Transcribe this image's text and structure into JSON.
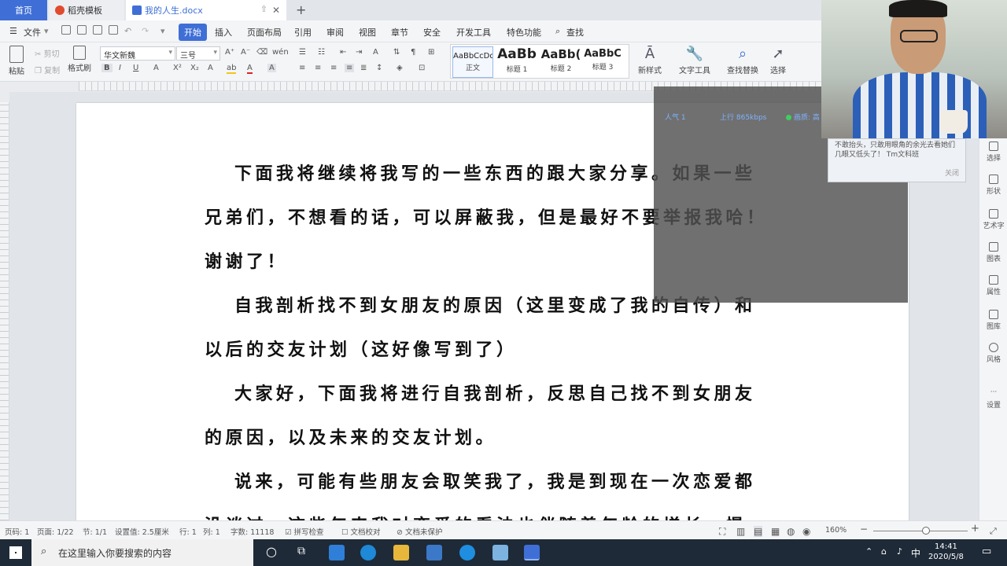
{
  "tabs": [
    {
      "label": "首页"
    },
    {
      "label": "稻壳模板"
    },
    {
      "label": "我的人生.docx"
    }
  ],
  "menu": {
    "file": "文件",
    "items": [
      "开始",
      "插入",
      "页面布局",
      "引用",
      "审阅",
      "视图",
      "章节",
      "安全",
      "开发工具",
      "特色功能"
    ],
    "search": "查找"
  },
  "ribbon": {
    "paste": "粘贴",
    "cut": "剪切",
    "copy": "复制",
    "format_painter": "格式刷",
    "font_name": "华文新魏",
    "font_size": "三号",
    "styles": [
      {
        "preview": "AaBbCcDd",
        "name": "正文"
      },
      {
        "preview": "AaBb",
        "name": "标题 1"
      },
      {
        "preview": "AaBb(",
        "name": "标题 2"
      },
      {
        "preview": "AaBbC",
        "name": "标题 3"
      }
    ],
    "new_style": "新样式",
    "text_tools": "文字工具",
    "find_replace": "查找替换",
    "select": "选择"
  },
  "document": {
    "paragraphs": [
      {
        "lines": [
          "下面我将继续将我写的一些东西的跟大家分享。如果一些",
          "兄弟们，不想看的话，可以屏蔽我，但是最好不要举报我哈！",
          "谢谢了！"
        ]
      },
      {
        "lines": [
          "自我剖析找不到女朋友的原因（这里变成了我的自传）和",
          "以后的交友计划（这好像写到了）"
        ]
      },
      {
        "lines": [
          "大家好，下面我将进行自我剖析，反思自己找不到女朋友",
          "的原因，以及未来的交友计划。"
        ]
      },
      {
        "lines": [
          "说来，可能有些朋友会取笑我了，我是到现在一次恋爱都",
          "没谈过，这些年来我对恋爱的看法也伴随着年龄的增长，慢"
        ]
      }
    ]
  },
  "overlay": {
    "popularity": "人气  1",
    "upload": "上行  865kbps",
    "quality": "画质: 高"
  },
  "chat": {
    "text": "不敢抬头，只敢用眼角的余光去看她们几眼又低头了！ Tm文科班",
    "close": "关闭"
  },
  "side_panel": [
    "选择",
    "形状",
    "艺术字",
    "图表",
    "属性",
    "图库",
    "风格",
    "设置"
  ],
  "status": {
    "page_code": "页码: 1",
    "page": "页面: 1/22",
    "section": "节: 1/1",
    "setting": "设置值: 2.5厘米",
    "row": "行: 1",
    "col": "列: 1",
    "words": "字数: 11118",
    "spell": "拼写检查",
    "proof": "文档校对",
    "protect": "文档未保护",
    "zoom": "160%"
  },
  "taskbar": {
    "search_placeholder": "在这里输入你要搜索的内容",
    "ime": "中",
    "time": "14:41",
    "date": "2020/5/8"
  }
}
